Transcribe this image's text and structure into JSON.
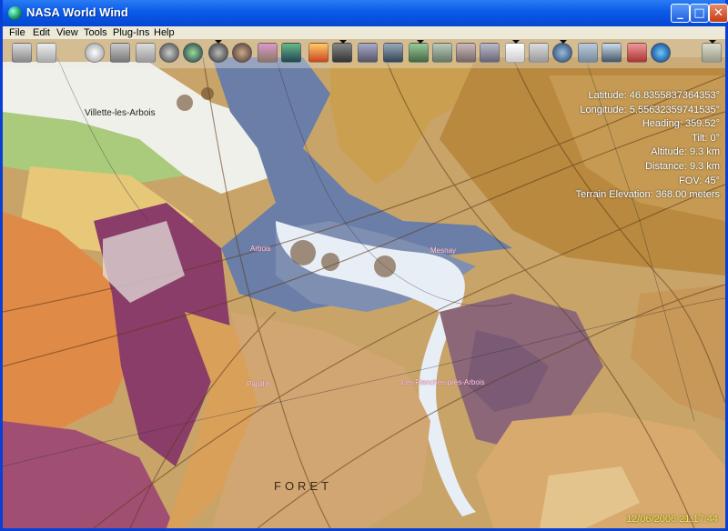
{
  "window": {
    "title": "NASA World Wind"
  },
  "menu": [
    "File",
    "Edit",
    "View",
    "Tools",
    "Plug-Ins",
    "Help"
  ],
  "titlebar_buttons": {
    "minimize": "_",
    "maximize": "□",
    "close": "✕"
  },
  "toolbar_icons": [
    "compass-icon",
    "layers-icon",
    "clock-icon",
    "world-icon",
    "globe-icon",
    "earth-icon",
    "moon-icon",
    "mars-icon",
    "jupiter-icon",
    "satellite-icon",
    "landsat-icon",
    "modis-icon",
    "animated-clouds-icon",
    "rapid-fire-icon",
    "terrain-icon",
    "topo-icon",
    "geology-icon",
    "usgs-icon",
    "map-icon",
    "search-icon",
    "bookmark-icon",
    "flag-icon",
    "places-icon",
    "info-icon",
    "ruler-icon",
    "placemark-icon"
  ],
  "hud": {
    "latitude": "Latitude: 46.8355837364353°",
    "longitude": "Longitude: 5.55632359741535°",
    "heading": "Heading: 359.52°",
    "tilt": "Tilt: 0°",
    "altitude": "Altitude: 9.3 km",
    "distance": "Distance: 9.3 km",
    "fov": "FOV: 45°",
    "terrain": "Terrain Elevation: 368.00 meters"
  },
  "datetime": "12/06/2006 21:17:44",
  "places": {
    "villette": "Villette-les-Arbois",
    "arbois": "Arbois",
    "mesnay": "Mesnay",
    "papillin": "Papillin",
    "planches": "Les Planches-près-Arbois",
    "foret": "FORET"
  },
  "colors": {
    "titlebar": "#0a5ae8",
    "hud_text": "#ffffff",
    "date_text": "#f2ea3c"
  }
}
